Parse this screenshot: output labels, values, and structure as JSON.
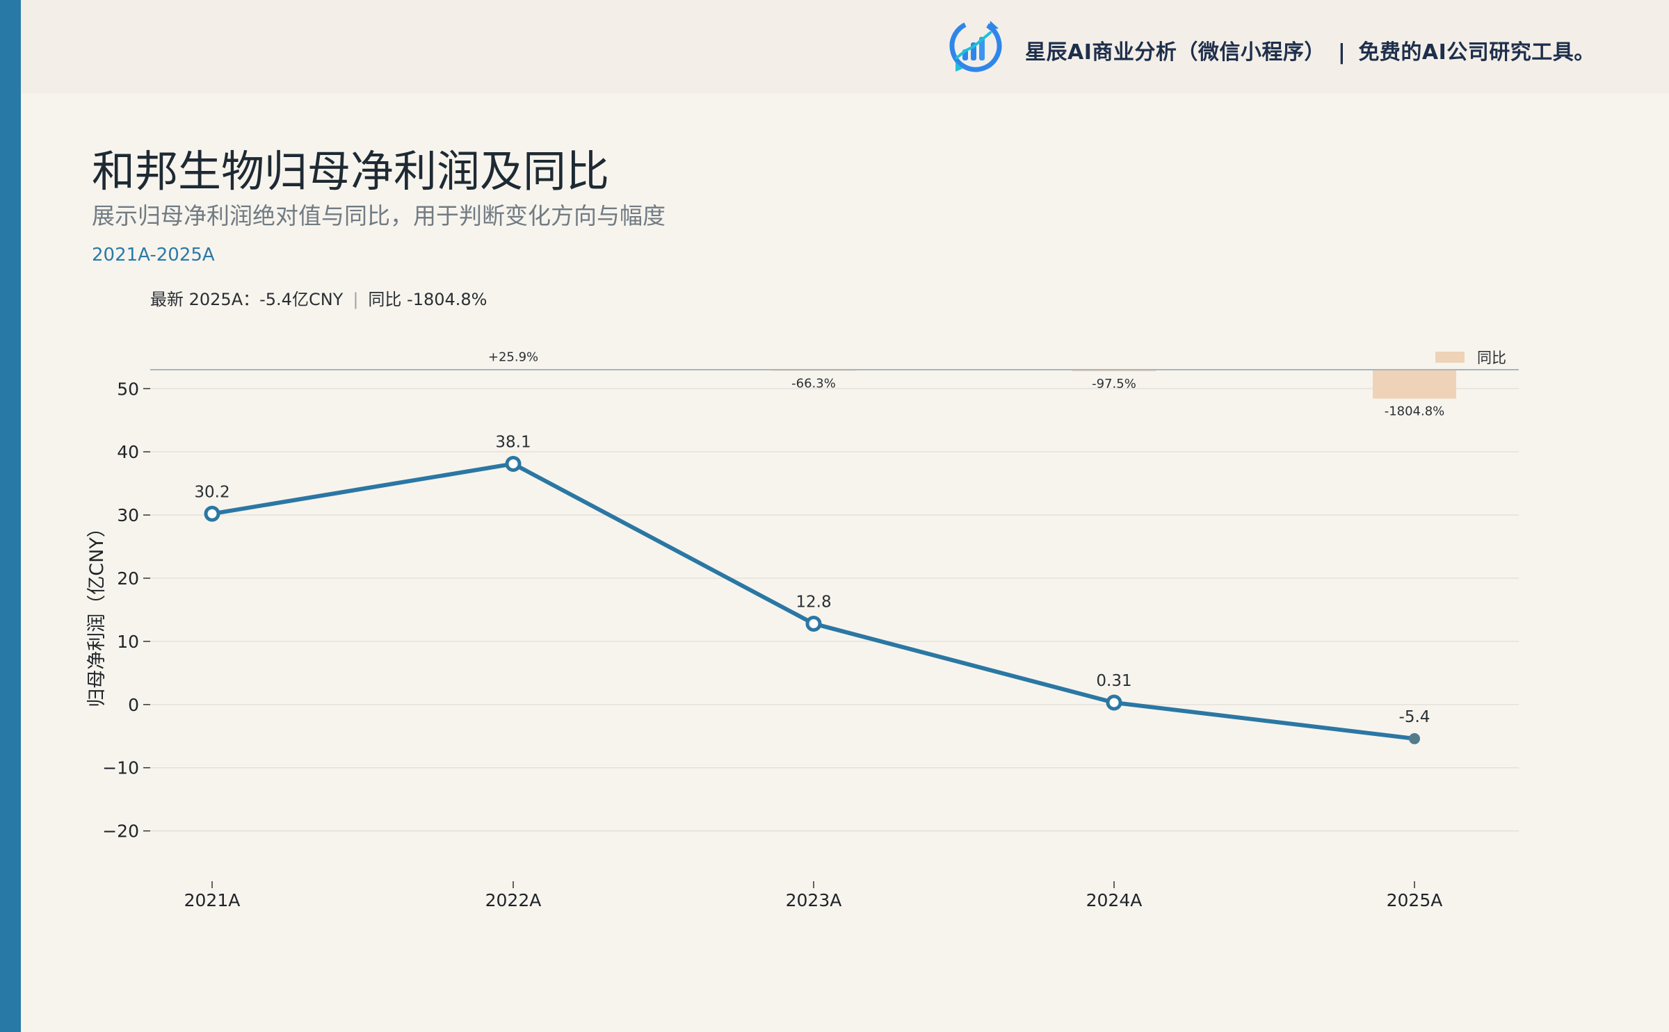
{
  "brand": {
    "name": "星辰AI商业分析（微信小程序）",
    "separator": "|",
    "tagline": "免费的AI公司研究工具。",
    "logo_icon": "bar-chart-growth-icon"
  },
  "title": "和邦生物归母净利润及同比",
  "subtitle": "展示归母净利润绝对值与同比，用于判断变化方向与幅度",
  "period": "2021A-2025A",
  "summary": {
    "latest": "最新 2025A：-5.4亿CNY",
    "separator": "|",
    "yoy": "同比 -1804.8%"
  },
  "colors": {
    "accent": "#2979a6",
    "line": "#2b77a3",
    "bar": "#eed3b8",
    "last_point": "#557a8c"
  },
  "chart_data": {
    "type": "line",
    "categories": [
      "2021A",
      "2022A",
      "2023A",
      "2024A",
      "2025A"
    ],
    "ylabel": "归母净利润（亿CNY）",
    "ylim": [
      -24,
      53
    ],
    "yticks": [
      50,
      40,
      30,
      20,
      10,
      0,
      -10,
      -20
    ],
    "ytick_labels": [
      "50",
      "40",
      "30",
      "20",
      "10",
      "0",
      "−10",
      "−20"
    ],
    "grid": true,
    "series": [
      {
        "kind": "line",
        "values": [
          30.2,
          38.1,
          12.8,
          0.31,
          -5.4
        ],
        "labels": [
          "30.2",
          "38.1",
          "12.8",
          "0.31",
          "-5.4"
        ]
      },
      {
        "name": "同比",
        "kind": "bar",
        "values": [
          null,
          25.9,
          -66.3,
          -97.5,
          -1804.8
        ],
        "labels": [
          "",
          "+25.9%",
          "-66.3%",
          "-97.5%",
          "-1804.8%"
        ]
      }
    ],
    "legend": {
      "position": "top-right",
      "label": "同比"
    }
  }
}
